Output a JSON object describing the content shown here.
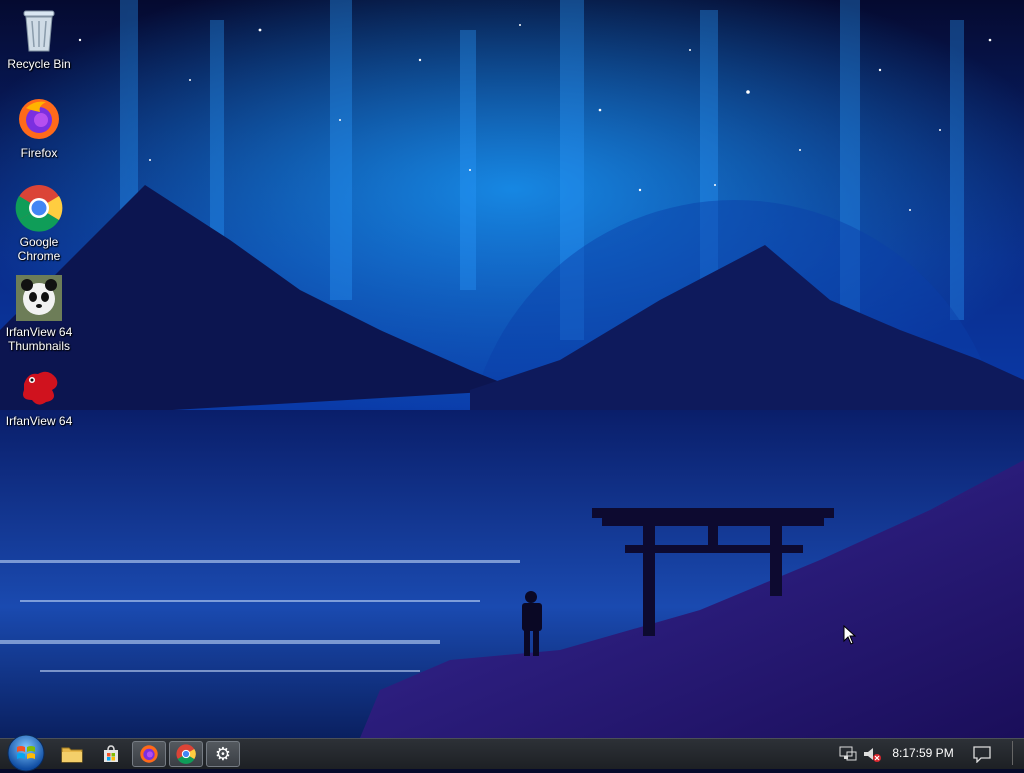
{
  "desktop": {
    "icons": [
      {
        "label": "Recycle Bin",
        "icon": "recycle-bin-icon"
      },
      {
        "label": "Firefox",
        "icon": "firefox-icon"
      },
      {
        "label": "Google\nChrome",
        "icon": "chrome-icon"
      },
      {
        "label": "IrfanView 64\nThumbnails",
        "icon": "panda-icon"
      },
      {
        "label": "IrfanView 64",
        "icon": "irfanview-icon"
      }
    ]
  },
  "taskbar": {
    "start": "start-orb",
    "pinned": [
      {
        "name": "file-explorer",
        "icon": "folder-icon",
        "active": false
      },
      {
        "name": "store",
        "icon": "store-bag-icon",
        "active": false
      },
      {
        "name": "firefox",
        "icon": "firefox-icon",
        "active": true
      },
      {
        "name": "chrome",
        "icon": "chrome-icon",
        "active": true
      },
      {
        "name": "settings",
        "icon": "gear-icon",
        "active": true
      }
    ],
    "tray": {
      "network": "network-icon",
      "volume": "volume-muted-icon",
      "clock": "8:17:59 PM",
      "notifications": "notification-icon"
    }
  }
}
